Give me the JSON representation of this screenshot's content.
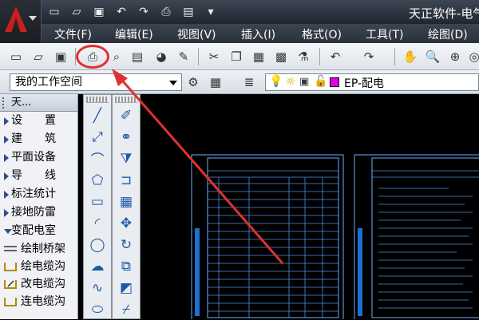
{
  "window": {
    "title": "天正软件-电气"
  },
  "menubar": {
    "items": [
      "文件(F)",
      "编辑(E)",
      "视图(V)",
      "插入(I)",
      "格式(O)",
      "工具(T)",
      "绘图(D)"
    ]
  },
  "workspace": {
    "selected": "我的工作空间"
  },
  "layer": {
    "name": "EP-配电"
  },
  "panel": {
    "title": "天...",
    "items": [
      {
        "label": "设　　置"
      },
      {
        "label": "建　　筑"
      },
      {
        "label": "平面设备"
      },
      {
        "label": "导　　线"
      },
      {
        "label": "标注统计"
      },
      {
        "label": "接地防雷"
      },
      {
        "label": "变配电室"
      }
    ],
    "sub_items": [
      {
        "label": "绘制桥架"
      },
      {
        "label": "绘电缆沟"
      },
      {
        "label": "改电缆沟"
      },
      {
        "label": "连电缆沟"
      }
    ]
  },
  "colors": {
    "accent_red": "#e03030",
    "sheet_blue": "#6ab0ff"
  }
}
